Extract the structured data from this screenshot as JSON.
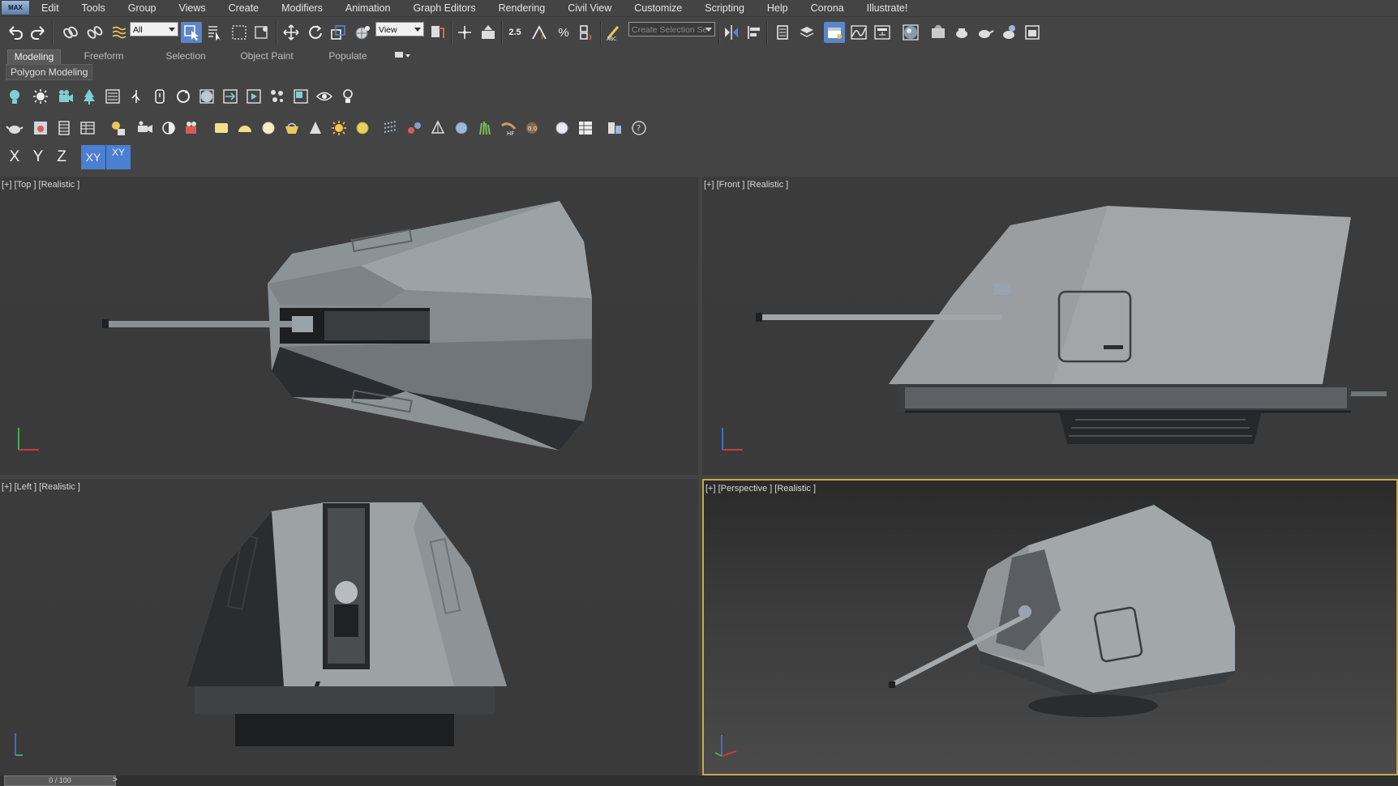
{
  "menu": {
    "logo": "MAX",
    "items": [
      "Edit",
      "Tools",
      "Group",
      "Views",
      "Create",
      "Modifiers",
      "Animation",
      "Graph Editors",
      "Rendering",
      "Civil View",
      "Customize",
      "Scripting",
      "Help",
      "Corona",
      "Illustrate!"
    ]
  },
  "toolbar": {
    "selection_filter": "All",
    "reference_coord": "View",
    "named_selection": "Create Selection Se",
    "snap_2_5": "2.5",
    "angle_snap_label": "∠",
    "percent_label": "%"
  },
  "ribbon": {
    "tabs": [
      "Modeling",
      "Freeform",
      "Selection",
      "Object Paint",
      "Populate"
    ],
    "active_tab": "Modeling",
    "sub_panel": "Polygon Modeling"
  },
  "axis_constraints": [
    "X",
    "Y",
    "Z",
    "XY",
    "XY"
  ],
  "viewports": {
    "top": "[+] [Top ] [Realistic ]",
    "front": "[+] [Front ] [Realistic ]",
    "left": "[+] [Left ] [Realistic ]",
    "perspective": "[+] [Perspective ] [Realistic ]"
  },
  "timeline": {
    "frame": "0 / 100",
    "next": ">"
  },
  "colors": {
    "accent": "#5b86c9",
    "active_viewport_border": "#c8a94a",
    "background": "#444444"
  }
}
